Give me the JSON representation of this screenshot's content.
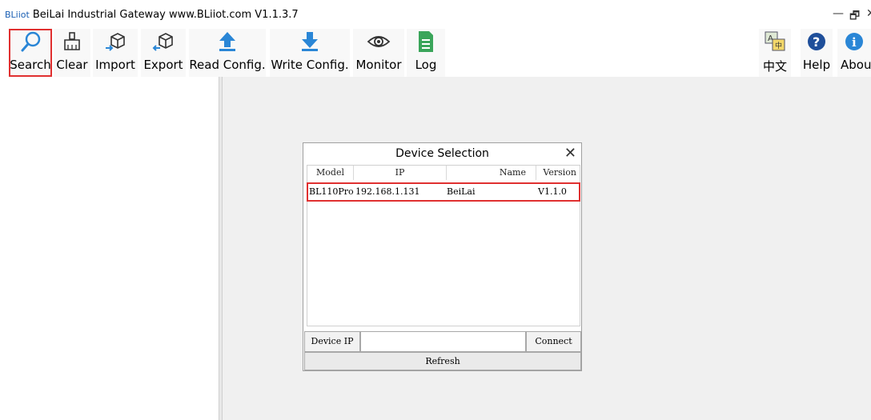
{
  "window": {
    "brand": "BLiiot",
    "title": "BeiLai Industrial Gateway www.BLiiot.com V1.1.3.7",
    "minimize": "—",
    "restore": "🗗",
    "close": "✕"
  },
  "toolbar": {
    "search": "Search",
    "clear": "Clear",
    "import": "Import",
    "export": "Export",
    "read_config": "Read Config.",
    "write_config": "Write Config.",
    "monitor": "Monitor",
    "log": "Log",
    "language": "中文",
    "help": "Help",
    "about": "Abou"
  },
  "icons": {
    "search": "magnifier-icon",
    "clear": "broom-icon",
    "import": "box-import-icon",
    "export": "box-export-icon",
    "read_config": "upload-arrow-icon",
    "write_config": "download-arrow-icon",
    "monitor": "eye-icon",
    "log": "document-icon",
    "language": "translate-icon",
    "help": "question-icon",
    "about": "info-icon"
  },
  "colors": {
    "highlight": "#e03030",
    "accent_blue": "#2a86d6",
    "log_green": "#3aa55a"
  },
  "dialog": {
    "title": "Device Selection",
    "close": "✕",
    "columns": [
      "Model",
      "IP",
      "Name",
      "Version"
    ],
    "rows": [
      {
        "model": "BL110Pro",
        "ip": "192.168.1.131",
        "name": "BeiLai",
        "version": "V1.1.0"
      }
    ],
    "device_ip_label": "Device IP",
    "ip_value": "",
    "connect_label": "Connect",
    "refresh_label": "Refresh"
  }
}
